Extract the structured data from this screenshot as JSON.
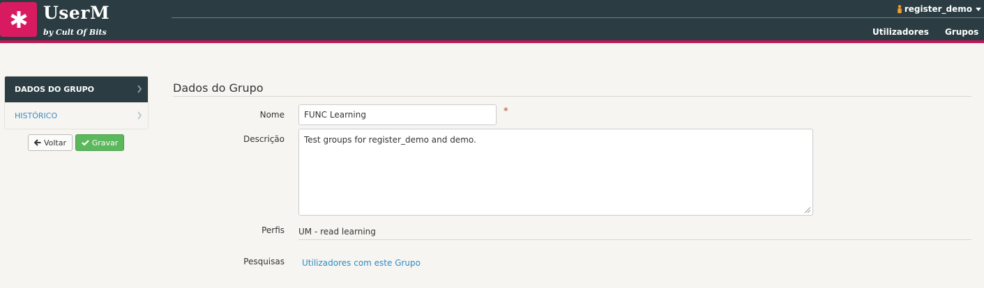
{
  "app": {
    "title": "UserM",
    "subtitle": "by Cult Of Bits",
    "logo_icon": "asterisk-icon",
    "brand_color": "#d81b60",
    "header_color": "#2b3d42"
  },
  "header": {
    "user": "register_demo",
    "nav": [
      "Utilizadores",
      "Grupos"
    ]
  },
  "sidebar": {
    "items": [
      {
        "label": "DADOS DO GRUPO",
        "active": true
      },
      {
        "label": "HISTÓRICO",
        "active": false
      }
    ],
    "back_label": "Voltar",
    "save_label": "Gravar"
  },
  "form": {
    "title": "Dados do Grupo",
    "name_label": "Nome",
    "name_value": "FUNC Learning",
    "required_mark": "*",
    "description_label": "Descrição",
    "description_value": "Test groups for register_demo and demo.",
    "profiles_label": "Perfis",
    "profiles_value": "UM - read learning",
    "searches_label": "Pesquisas",
    "searches_link": "Utilizadores com este Grupo"
  }
}
